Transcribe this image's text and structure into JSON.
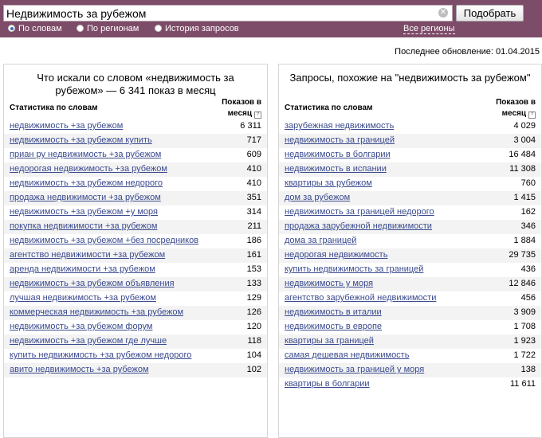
{
  "search": {
    "query": "Недвижимость за рубежом",
    "clear": "✕",
    "submit_label": "Подобрать"
  },
  "modes": [
    {
      "label": "По словам",
      "checked": true
    },
    {
      "label": "По регионам",
      "checked": false
    },
    {
      "label": "История запросов",
      "checked": false
    }
  ],
  "regions_link": "Все регионы",
  "last_update": "Последнее обновление: 01.04.2015",
  "left_panel": {
    "title": "Что искали со словом «недвижимость за рубежом» — 6 341 показ в месяц",
    "col_phrase": "Статистика по словам",
    "col_count": "Показов в месяц",
    "rows": [
      {
        "phrase": "недвижимость +за рубежом",
        "count": "6 311"
      },
      {
        "phrase": "недвижимость +за рубежом купить",
        "count": "717"
      },
      {
        "phrase": "приан ру недвижимость +за рубежом",
        "count": "609"
      },
      {
        "phrase": "недорогая недвижимость +за рубежом",
        "count": "410"
      },
      {
        "phrase": "недвижимость +за рубежом недорого",
        "count": "410"
      },
      {
        "phrase": "продажа недвижимости +за рубежом",
        "count": "351"
      },
      {
        "phrase": "недвижимость +за рубежом +у моря",
        "count": "314"
      },
      {
        "phrase": "покупка недвижимости +за рубежом",
        "count": "211"
      },
      {
        "phrase": "недвижимость +за рубежом +без посредников",
        "count": "186"
      },
      {
        "phrase": "агентство недвижимости +за рубежом",
        "count": "161"
      },
      {
        "phrase": "аренда недвижимости +за рубежом",
        "count": "153"
      },
      {
        "phrase": "недвижимость +за рубежом объявления",
        "count": "133"
      },
      {
        "phrase": "лучшая недвижимость +за рубежом",
        "count": "129"
      },
      {
        "phrase": "коммерческая недвижимость +за рубежом",
        "count": "126"
      },
      {
        "phrase": "недвижимость +за рубежом форум",
        "count": "120"
      },
      {
        "phrase": "недвижимость +за рубежом где лучше",
        "count": "118"
      },
      {
        "phrase": "купить недвижимость +за рубежом недорого",
        "count": "104"
      },
      {
        "phrase": "авито недвижимость +за рубежом",
        "count": "102"
      }
    ]
  },
  "right_panel": {
    "title": "Запросы, похожие на \"недвижимость за рубежом\"",
    "col_phrase": "Статистика по словам",
    "col_count": "Показов в месяц",
    "rows": [
      {
        "phrase": "зарубежная недвижимость",
        "count": "4 029"
      },
      {
        "phrase": "недвижимость за границей",
        "count": "3 004"
      },
      {
        "phrase": "недвижимость в болгарии",
        "count": "16 484"
      },
      {
        "phrase": "недвижимость в испании",
        "count": "11 308"
      },
      {
        "phrase": "квартиры за рубежом",
        "count": "760"
      },
      {
        "phrase": "дом за рубежом",
        "count": "1 415"
      },
      {
        "phrase": "недвижимость за границей недорого",
        "count": "162"
      },
      {
        "phrase": "продажа зарубежной недвижимости",
        "count": "346"
      },
      {
        "phrase": "дома за границей",
        "count": "1 884"
      },
      {
        "phrase": "недорогая недвижимость",
        "count": "29 735"
      },
      {
        "phrase": "купить недвижимость за границей",
        "count": "436"
      },
      {
        "phrase": "недвижимость у моря",
        "count": "12 846"
      },
      {
        "phrase": "агентство зарубежной недвижимости",
        "count": "456"
      },
      {
        "phrase": "недвижимость в италии",
        "count": "3 909"
      },
      {
        "phrase": "недвижимость в европе",
        "count": "1 708"
      },
      {
        "phrase": "квартиры за границей",
        "count": "1 923"
      },
      {
        "phrase": "самая дешевая недвижимость",
        "count": "1 722"
      },
      {
        "phrase": "недвижимость за границей у моря",
        "count": "138"
      },
      {
        "phrase": "квартиры в болгарии",
        "count": "11 611"
      }
    ]
  }
}
